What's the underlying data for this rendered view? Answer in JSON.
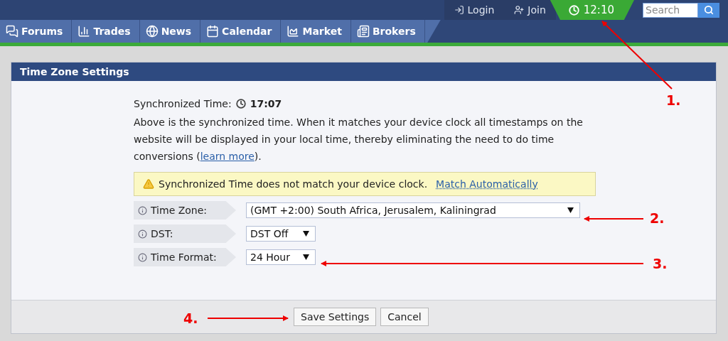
{
  "top_bar": {
    "links": [
      {
        "label": "Login",
        "kind": "login"
      },
      {
        "label": "Join",
        "kind": "join"
      }
    ],
    "clock": "12:10",
    "search": {
      "placeholder": "Search"
    }
  },
  "nav": [
    {
      "label": "Forums",
      "kind": "forums"
    },
    {
      "label": "Trades",
      "kind": "trades"
    },
    {
      "label": "News",
      "kind": "news"
    },
    {
      "label": "Calendar",
      "kind": "calendar"
    },
    {
      "label": "Market",
      "kind": "market"
    },
    {
      "label": "Brokers",
      "kind": "brokers"
    }
  ],
  "panel": {
    "title": "Time Zone Settings",
    "sync_label": "Synchronized Time:",
    "sync_time": "17:07",
    "description": {
      "before": "Above is the synchronized time. When it matches your device clock all timestamps on the website will be displayed in your local time, thereby eliminating the need to do time conversions (",
      "link": "learn more",
      "after": ")."
    },
    "warning": {
      "text": "Synchronized Time does not match your device clock.",
      "link": "Match Automatically"
    },
    "fields": [
      {
        "label": "Time Zone:",
        "value": "(GMT +2:00) South Africa, Jerusalem, Kaliningrad",
        "kind": "wide"
      },
      {
        "label": "DST:",
        "value": "DST Off",
        "kind": "narrow"
      },
      {
        "label": "Time Format:",
        "value": "24 Hour",
        "kind": "narrow"
      }
    ],
    "buttons": [
      "Save Settings",
      "Cancel"
    ]
  },
  "annotations": [
    {
      "label": "1."
    },
    {
      "label": "2."
    },
    {
      "label": "3."
    },
    {
      "label": "4."
    }
  ]
}
